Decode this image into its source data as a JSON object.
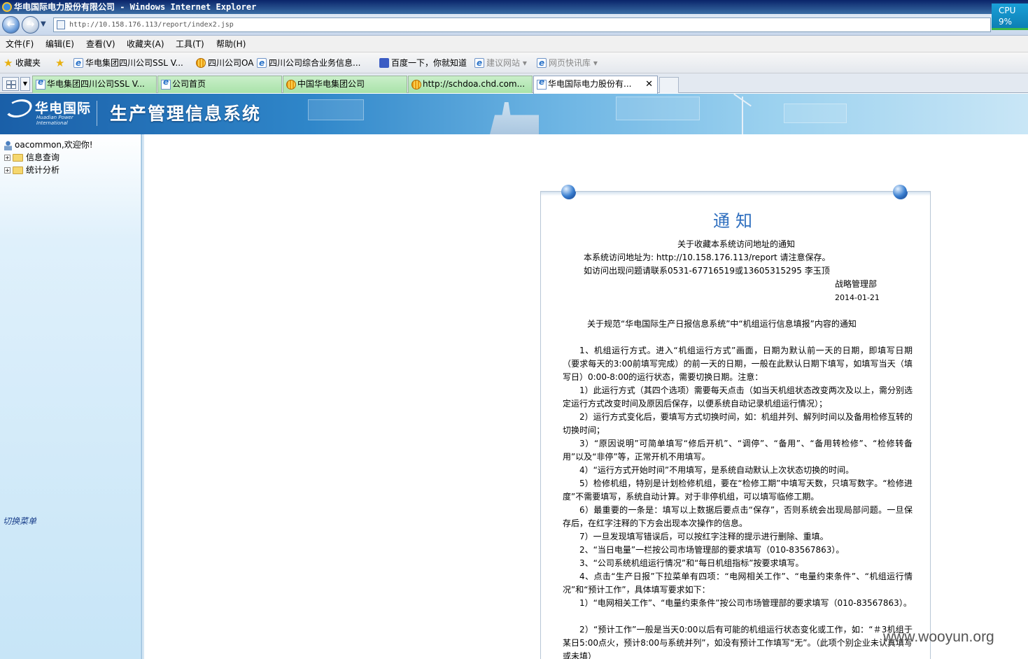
{
  "window": {
    "title": "华电国际电力股份有限公司 - Windows Internet Explorer"
  },
  "address_bar": {
    "url": "http://10.158.176.113/report/index2.jsp"
  },
  "cpu_widget": {
    "label": "CPU",
    "value": "9%"
  },
  "menu": [
    {
      "label": "文件(F)"
    },
    {
      "label": "编辑(E)"
    },
    {
      "label": "查看(V)"
    },
    {
      "label": "收藏夹(A)"
    },
    {
      "label": "工具(T)"
    },
    {
      "label": "帮助(H)"
    }
  ],
  "favorites_bar": {
    "label": "收藏夹",
    "items": [
      {
        "label": "华电集团四川公司SSL V...",
        "icon": "ie-page-icon"
      },
      {
        "label": "四川公司OA",
        "icon": "huadian-logo-icon"
      },
      {
        "label": "四川公司综合业务信息...",
        "icon": "ie-page-icon"
      },
      {
        "label": "百度一下，你就知道",
        "icon": "baidu-paw-icon"
      },
      {
        "label": "建议网站 ▾",
        "icon": "ie-page-icon"
      },
      {
        "label": "网页快讯库 ▾",
        "icon": "ie-page-icon"
      }
    ]
  },
  "tabs": [
    {
      "label": "华电集团四川公司SSL V...",
      "active": false
    },
    {
      "label": "公司首页",
      "active": false
    },
    {
      "label": "中国华电集团公司",
      "active": false
    },
    {
      "label": "http://schdoa.chd.com...",
      "active": false
    },
    {
      "label": "华电国际电力股份有...",
      "active": true
    }
  ],
  "banner": {
    "logo_cn": "华电国际",
    "logo_en_1": "Huadian Power",
    "logo_en_2": "International",
    "system_title": "生产管理信息系统"
  },
  "sidebar": {
    "welcome": "oacommon,欢迎你!",
    "tree": [
      {
        "label": "信息查询"
      },
      {
        "label": "统计分析"
      }
    ],
    "switch_menu": "切换菜单"
  },
  "notice": {
    "title": "通知",
    "n1": {
      "heading": "关于收藏本系统访问地址的通知",
      "line1": "本系统访问地址为: http://10.158.176.113/report  请注意保存。",
      "line2": "如访问出现问题请联系0531-67716519或13605315295 李玉顶",
      "dept": "战略管理部",
      "date": "2014-01-21"
    },
    "n2": {
      "heading": "关于规范“华电国际生产日报信息系统”中“机组运行信息填报”内容的通知",
      "paragraphs": [
        "1、机组运行方式。进入“机组运行方式”画面，日期为默认前一天的日期，即填写日期（要求每天的3:00前填写完成）的前一天的日期，一般在此默认日期下填写，如填写当天（填写日）0:00-8:00的运行状态，需要切换日期。注意：",
        "1）此运行方式（其四个选项）需要每天点击（如当天机组状态改变两次及以上，需分别选定运行方式改变时间及原因后保存，以便系统自动记录机组运行情况）；",
        "2）运行方式变化后，要填写方式切换时间，如：机组并列、解列时间以及备用检修互转的切换时间；",
        "3）“原因说明”可简单填写“修后开机”、“调停”、“备用”、“备用转检修”、“检修转备用”以及“非停”等，正常开机不用填写。",
        "4）“运行方式开始时间”不用填写，是系统自动默认上次状态切换的时间。",
        "5）检修机组，特别是计划检修机组，要在“检修工期”中填写天数，只填写数字。“检修进度”不需要填写，系统自动计算。对于非停机组，可以填写临修工期。",
        "6）最重要的一条是：填写以上数据后要点击“保存”，否则系统会出现局部问题。一旦保存后，在红字注释的下方会出现本次操作的信息。",
        "7）一旦发现填写错误后，可以按红字注释的提示进行删除、重填。",
        "2、“当日电量”一栏按公司市场管理部的要求填写（010-83567863）。",
        "3、“公司系统机组运行情况”和“每日机组指标”按要求填写。",
        "4、点击“生产日报”下拉菜单有四项：“电网相关工作”、“电量约束条件”、“机组运行情况”和“预计工作”，具体填写要求如下：",
        "1）“电网相关工作”、“电量约束条件”按公司市场管理部的要求填写（010-83567863）。",
        "2）“预计工作”一般是当天0:00以后有可能的机组运行状态变化或工作，如：“＃3机组于某日5:00点火，预计8:00与系统并列”，如没有预计工作填写“无”。（此项个别企业未认真填写或未填）"
      ]
    }
  },
  "watermark": "www.wooyun.org"
}
